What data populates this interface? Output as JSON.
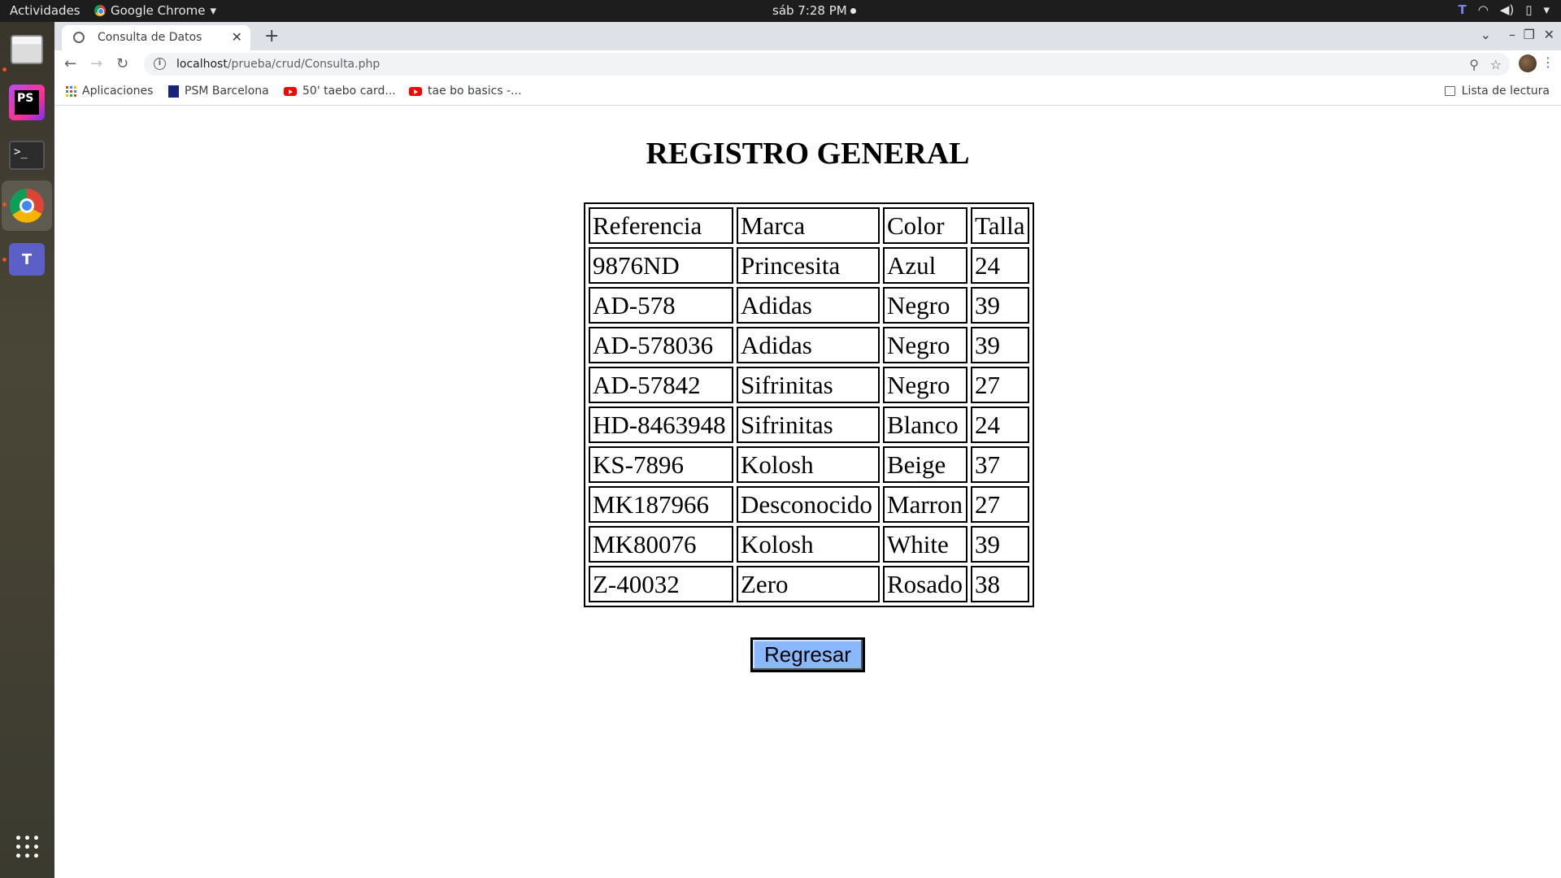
{
  "system_bar": {
    "activities": "Actividades",
    "app_name": "Google Chrome",
    "clock": "sáb  7:28 PM"
  },
  "browser": {
    "tab_title": "Consulta de Datos",
    "url_host": "localhost",
    "url_path": "/prueba/crud/Consulta.php",
    "bookmarks": [
      "Aplicaciones",
      "PSM Barcelona",
      "50' taebo card...",
      "tae bo basics -..."
    ],
    "reading_list": "Lista de lectura"
  },
  "page": {
    "title": "REGISTRO GENERAL",
    "table": {
      "headers": [
        "Referencia",
        "Marca",
        "Color",
        "Talla"
      ],
      "rows": [
        [
          "9876ND",
          "Princesita",
          "Azul",
          "24"
        ],
        [
          "AD-578",
          "Adidas",
          "Negro",
          "39"
        ],
        [
          "AD-578036",
          "Adidas",
          "Negro",
          "39"
        ],
        [
          "AD-57842",
          "Sifrinitas",
          "Negro",
          "27"
        ],
        [
          "HD-8463948",
          "Sifrinitas",
          "Blanco",
          "24"
        ],
        [
          "KS-7896",
          "Kolosh",
          "Beige",
          "37"
        ],
        [
          "MK187966",
          "Desconocido",
          "Marron",
          "27"
        ],
        [
          "MK80076",
          "Kolosh",
          "White",
          "39"
        ],
        [
          "Z-40032",
          "Zero",
          "Rosado",
          "38"
        ]
      ]
    },
    "back_button": "Regresar"
  },
  "colors": {
    "button_bg": "#8ab8ff",
    "dock_bg": "#3a352c",
    "topbar_bg": "#1d1d1d"
  },
  "icons": [
    "chrome-icon",
    "files-icon",
    "phpstorm-icon",
    "terminal-icon",
    "teams-icon",
    "apps-grid-icon",
    "search-zoom-icon",
    "star-icon"
  ]
}
